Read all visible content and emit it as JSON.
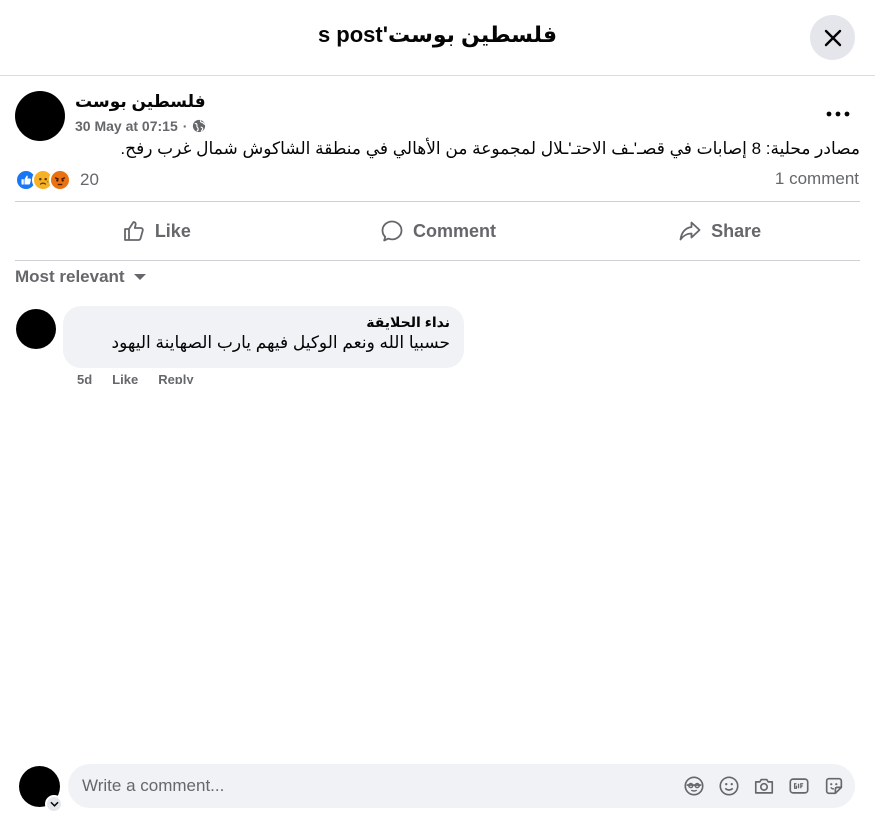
{
  "header": {
    "title": "فلسطين بوست's post"
  },
  "post": {
    "author": "فلسطين بوست",
    "timestamp": "30 May at 07:15",
    "privacy_icon": "globe-icon",
    "text": "مصادر محلية: 8 إصابات في قصـ'ـف الاحتـ'ـلال لمجموعة من الأهالي في منطقة الشاكوش شمال غرب رفح.",
    "reactions": [
      "like",
      "sad",
      "angry"
    ],
    "reaction_count": "20",
    "comment_count": "1 comment"
  },
  "actions": {
    "like": "Like",
    "comment": "Comment",
    "share": "Share"
  },
  "comments_section": {
    "sort_label": "Most relevant"
  },
  "comments": [
    {
      "author": "نداء الحلايقة",
      "text": "حسبيا الله ونعم الوكيل فيهم يارب الصهاينة اليهود",
      "age": "5d",
      "like": "Like",
      "reply": "Reply"
    }
  ],
  "composer": {
    "placeholder": "Write a comment..."
  },
  "colors": {
    "brand": "#1877f2",
    "secondary_text": "#65676b",
    "surface": "#f0f2f5"
  }
}
